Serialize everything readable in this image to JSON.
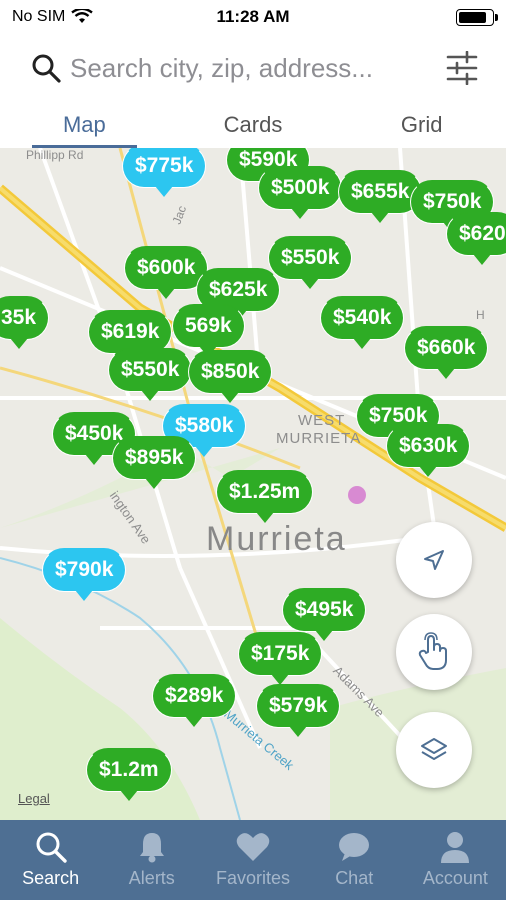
{
  "status": {
    "carrier": "No SIM",
    "time": "11:28 AM",
    "battery_level": 0.85
  },
  "search": {
    "placeholder": "Search city, zip, address..."
  },
  "tabs": [
    {
      "label": "Map",
      "active": true
    },
    {
      "label": "Cards",
      "active": false
    },
    {
      "label": "Grid",
      "active": false
    }
  ],
  "map": {
    "city_label": "Murrieta",
    "area_label_1": "WEST",
    "area_label_2": "MURRIETA",
    "street_labels": [
      "Phillipp Rd",
      "Jac",
      "ington Ave",
      "Adams Ave",
      "Murrieta Creek",
      "H"
    ],
    "legal": "Legal",
    "pins": [
      {
        "price": "$775k",
        "color": "blue"
      },
      {
        "price": "$590k",
        "color": "green"
      },
      {
        "price": "$500k",
        "color": "green"
      },
      {
        "price": "$655k",
        "color": "green"
      },
      {
        "price": "$750k",
        "color": "green"
      },
      {
        "price": "$620",
        "color": "green"
      },
      {
        "price": "$600k",
        "color": "green"
      },
      {
        "price": "$550k",
        "color": "green"
      },
      {
        "price": "$625k",
        "color": "green"
      },
      {
        "price": "$540k",
        "color": "green"
      },
      {
        "price": "35k",
        "color": "green"
      },
      {
        "price": "$619k",
        "color": "green"
      },
      {
        "price": "569k",
        "color": "green"
      },
      {
        "price": "$550k",
        "color": "green"
      },
      {
        "price": "$850k",
        "color": "green"
      },
      {
        "price": "$660k",
        "color": "green"
      },
      {
        "price": "$450k",
        "color": "green"
      },
      {
        "price": "$580k",
        "color": "blue"
      },
      {
        "price": "$895k",
        "color": "green"
      },
      {
        "price": "$750k",
        "color": "green"
      },
      {
        "price": "$630k",
        "color": "green"
      },
      {
        "price": "$1.25m",
        "color": "green"
      },
      {
        "price": "$790k",
        "color": "blue"
      },
      {
        "price": "$495k",
        "color": "green"
      },
      {
        "price": "$175k",
        "color": "green"
      },
      {
        "price": "$289k",
        "color": "green"
      },
      {
        "price": "$579k",
        "color": "green"
      },
      {
        "price": "$1.2m",
        "color": "green"
      }
    ]
  },
  "fabs": [
    {
      "icon": "location-arrow-icon"
    },
    {
      "icon": "hand-tap-icon"
    },
    {
      "icon": "layers-icon"
    }
  ],
  "tabbar": [
    {
      "label": "Search",
      "icon": "search-icon",
      "active": true
    },
    {
      "label": "Alerts",
      "icon": "bell-icon",
      "active": false
    },
    {
      "label": "Favorites",
      "icon": "heart-icon",
      "active": false
    },
    {
      "label": "Chat",
      "icon": "chat-icon",
      "active": false
    },
    {
      "label": "Account",
      "icon": "person-icon",
      "active": false
    }
  ]
}
